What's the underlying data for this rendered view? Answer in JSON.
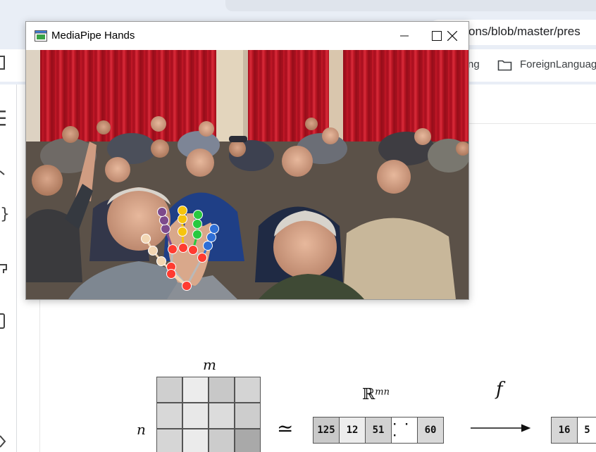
{
  "browser": {
    "address_partial": "ons/blob/master/pres",
    "bookmarks": [
      {
        "label": "ng"
      },
      {
        "label": "ForeignLanguag",
        "icon": "folder-icon"
      }
    ]
  },
  "left_rail": {
    "icons": [
      "menu-icon",
      "chevron-icon",
      "brace-icon",
      "shape-icon",
      "panel-icon",
      "collapse-icon"
    ]
  },
  "window": {
    "title": "MediaPipe Hands",
    "icon": "app-window-icon",
    "controls": [
      "minimize-icon",
      "maximize-icon",
      "close-icon"
    ]
  },
  "video": {
    "description_free": true,
    "landmark_colors": {
      "thumb": "#f2d6b3",
      "index": "#7d4a8c",
      "middle": "#f6c40e",
      "ring": "#27c93f",
      "pinky": "#2f6fd6",
      "palm": "#ff3b30"
    }
  },
  "math": {
    "m_label": "m",
    "n_label": "n",
    "approx_symbol": "≃",
    "space_label": "ℝ",
    "space_exponent": "mn",
    "f_label": "f",
    "matrix_cells": [
      [
        "#cfcfcf",
        "#ececec",
        "#c8c8c8",
        "#d4d4d4"
      ],
      [
        "#d8d8d8",
        "#e8e8e8",
        "#dcdcdc",
        "#cdcdcd"
      ],
      [
        "#d6d6d6",
        "#ebebeb",
        "#cccccc",
        "#a9a9a9"
      ]
    ],
    "vector": [
      {
        "text": "125",
        "shade": "#c9c9c9"
      },
      {
        "text": "12",
        "shade": "#ededed"
      },
      {
        "text": "51",
        "shade": "#d2d2d2"
      },
      {
        "text": "· · ·",
        "shade": "#ffffff"
      },
      {
        "text": "60",
        "shade": "#d9d9d9"
      }
    ],
    "output_vector": [
      {
        "text": "16",
        "shade": "#d6d6d6"
      },
      {
        "text": "5",
        "shade": "#ffffff"
      }
    ]
  }
}
